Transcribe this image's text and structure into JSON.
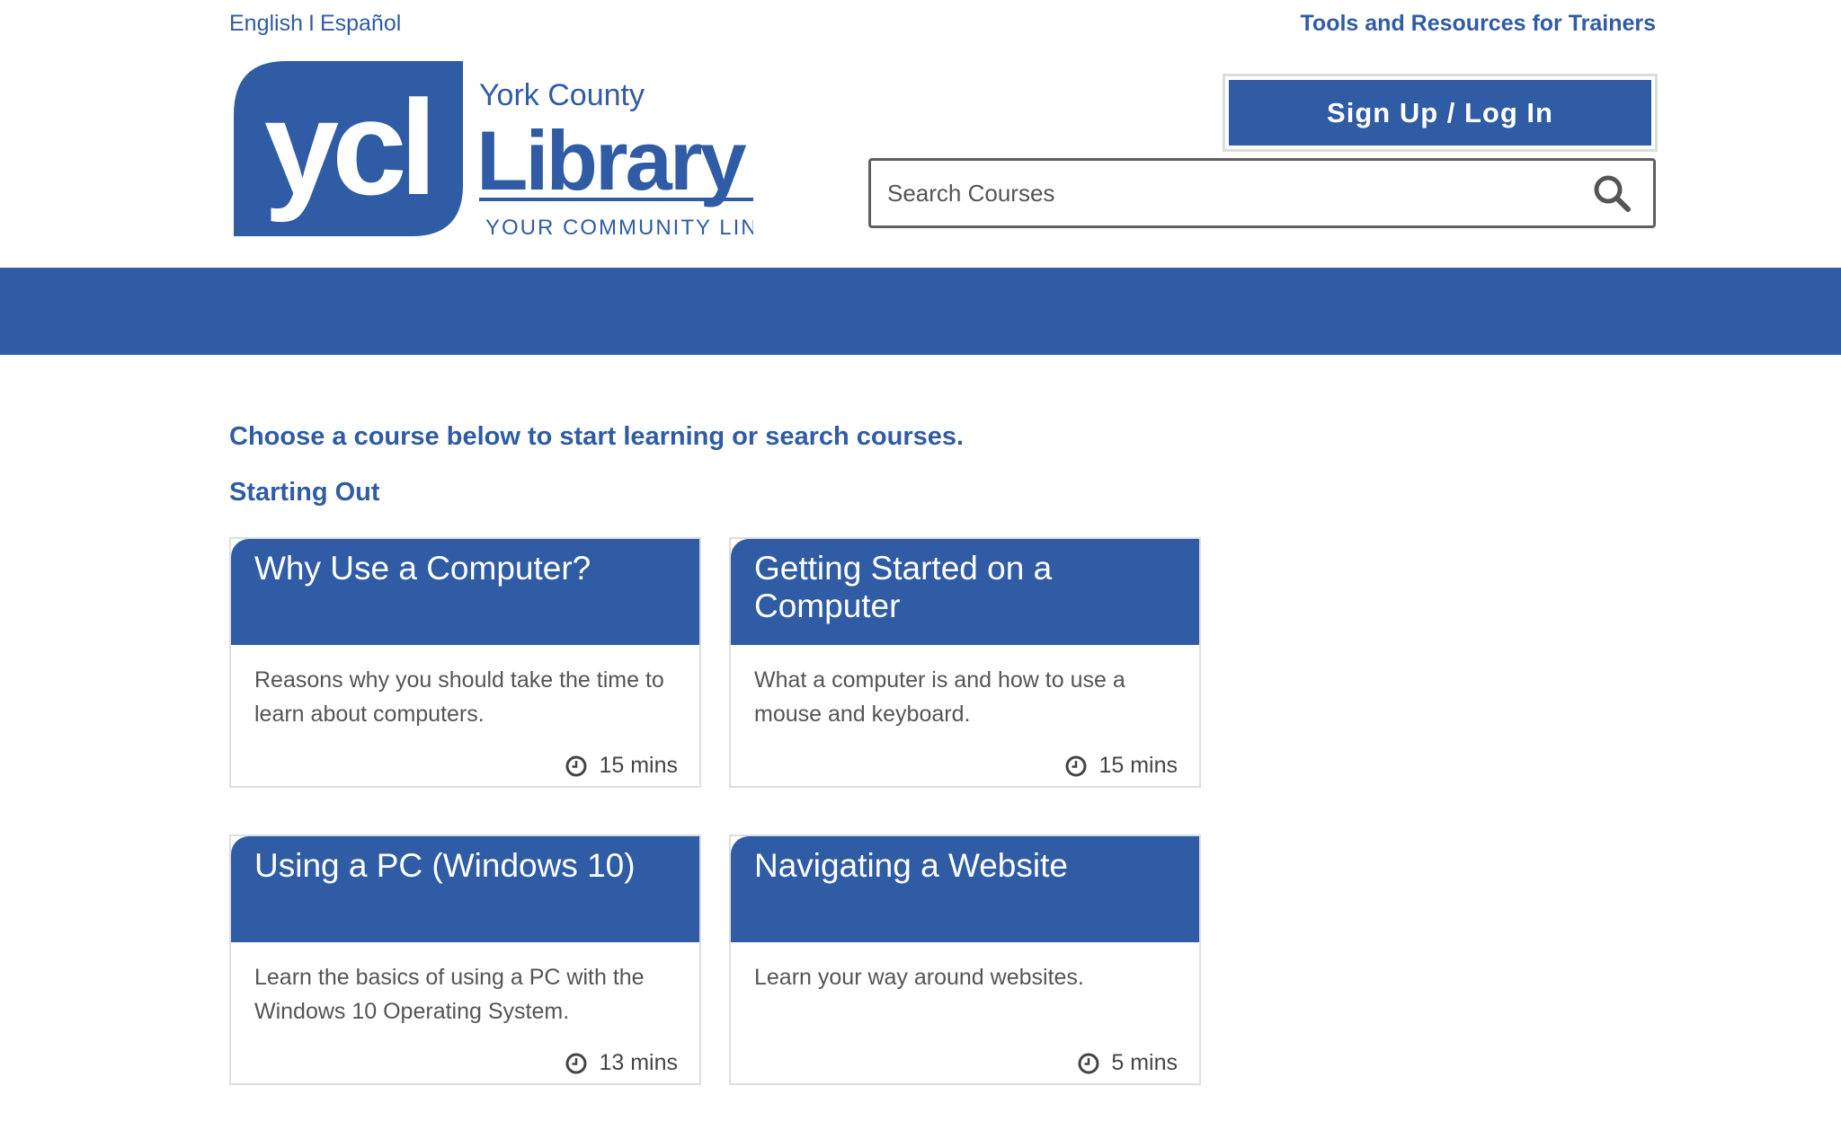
{
  "header": {
    "lang_english": "English",
    "lang_separator": "I",
    "lang_spanish": "Español",
    "trainers_link": "Tools and Resources for Trainers",
    "signup_button": "Sign Up / Log In",
    "search_placeholder": "Search Courses"
  },
  "logo": {
    "mark": "ycl",
    "line1": "York County",
    "line2": "Library",
    "tagline": "YOUR COMMUNITY LINK"
  },
  "colors": {
    "brand_blue": "#2f5ca4"
  },
  "main": {
    "intro": "Choose a course below to start learning or search courses.",
    "section_title": "Starting Out",
    "courses": [
      {
        "title": "Why Use a Computer?",
        "description": "Reasons why you should take the time to learn about computers.",
        "duration": "15 mins",
        "icon": "clock-icon"
      },
      {
        "title": "Getting Started on a Computer",
        "description": "What a computer is and how to use a mouse and keyboard.",
        "duration": "15 mins",
        "icon": "clock-icon"
      },
      {
        "title": "Using a PC (Windows 10)",
        "description": "Learn the basics of using a PC with the Windows 10 Operating System.",
        "duration": "13 mins",
        "icon": "clock-icon"
      },
      {
        "title": "Navigating a Website",
        "description": "Learn your way around websites.",
        "duration": "5 mins",
        "icon": "clock-icon"
      }
    ]
  }
}
